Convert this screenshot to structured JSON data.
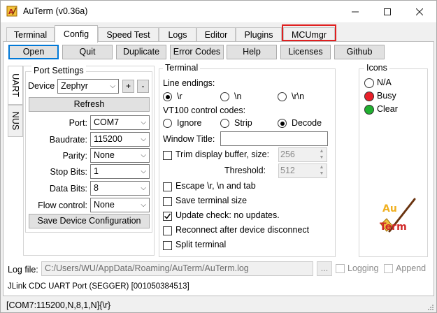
{
  "window": {
    "title": "AuTerm (v0.36a)"
  },
  "tabs": [
    {
      "label": "Terminal"
    },
    {
      "label": "Config"
    },
    {
      "label": "Speed Test"
    },
    {
      "label": "Logs"
    },
    {
      "label": "Editor"
    },
    {
      "label": "Plugins"
    },
    {
      "label": "MCUmgr"
    }
  ],
  "toolbar": {
    "open": "Open",
    "quit": "Quit",
    "duplicate": "Duplicate",
    "error_codes": "Error Codes",
    "help": "Help",
    "licenses": "Licenses",
    "github": "Github"
  },
  "side_tabs": {
    "uart": "UART",
    "nus": "NUS"
  },
  "port_settings": {
    "legend": "Port Settings",
    "device_label": "Device",
    "device_value": "Zephyr",
    "add": "+",
    "remove": "-",
    "refresh": "Refresh",
    "port_label": "Port:",
    "port_value": "COM7",
    "baudrate_label": "Baudrate:",
    "baudrate_value": "115200",
    "parity_label": "Parity:",
    "parity_value": "None",
    "stopbits_label": "Stop Bits:",
    "stopbits_value": "1",
    "databits_label": "Data Bits:",
    "databits_value": "8",
    "flow_label": "Flow control:",
    "flow_value": "None",
    "save": "Save Device Configuration"
  },
  "terminal": {
    "legend": "Terminal",
    "line_endings_label": "Line endings:",
    "le_r": "\\r",
    "le_n": "\\n",
    "le_rn": "\\r\\n",
    "vt100_label": "VT100 control codes:",
    "vt_ignore": "Ignore",
    "vt_strip": "Strip",
    "vt_decode": "Decode",
    "window_title_label": "Window Title:",
    "window_title_value": "",
    "trim_label": "Trim display buffer, size:",
    "trim_value": "256",
    "threshold_label": "Threshold:",
    "threshold_value": "512",
    "escape_label": "Escape \\r, \\n and tab",
    "save_size_label": "Save terminal size",
    "update_label": "Update check: no updates.",
    "reconnect_label": "Reconnect after device disconnect",
    "split_label": "Split terminal"
  },
  "icons": {
    "legend": "Icons",
    "na": "N/A",
    "busy": "Busy",
    "clear": "Clear",
    "busy_color": "#e8202a",
    "clear_color": "#20b030",
    "logo_text": "Au Term"
  },
  "log": {
    "label": "Log file:",
    "path": "C:/Users/WU/AppData/Roaming/AuTerm/AuTerm.log",
    "browse": "...",
    "logging": "Logging",
    "append": "Append"
  },
  "device_info": "JLink CDC UART Port (SEGGER) [001050384513]",
  "status_bar": "[COM7:115200,N,8,1,N]{\\r}",
  "highlight_color": "#e02020",
  "accent_color": "#0078d7"
}
